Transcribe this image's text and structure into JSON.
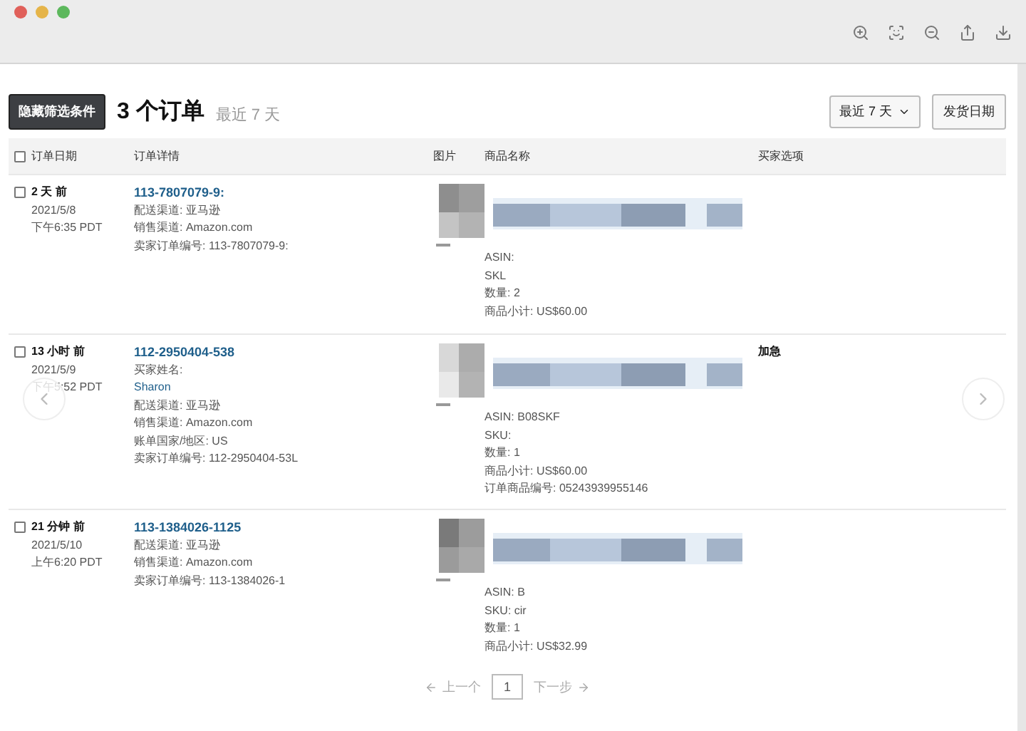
{
  "toolbar": {
    "filter_button": "隐藏筛选条件",
    "title": "3 个订单",
    "subtitle": "最近 7 天",
    "range_select": "最近 7 天",
    "sort_button": "发货日期"
  },
  "table": {
    "select_all": {
      "checked": false
    },
    "columns": [
      "订单日期",
      "订单详情",
      "图片",
      "商品名称",
      "买家选项"
    ],
    "rows": [
      {
        "checked": false,
        "age": "2 天 前",
        "date": "2021/5/8",
        "time": "下午6:35 PDT",
        "order_id": "113-7807079-9:",
        "details": [
          {
            "kind": "text",
            "text": "配送渠道: 亚马逊"
          },
          {
            "kind": "text",
            "text": "销售渠道: Amazon.com"
          },
          {
            "kind": "text",
            "text": "卖家订单编号: 113-7807079-9:"
          }
        ],
        "product": [
          "ASIN:",
          "SKL",
          "数量: 2",
          "商品小计: US$60.00"
        ],
        "buyer_option": null
      },
      {
        "checked": false,
        "age": "13 小时 前",
        "date": "2021/5/9",
        "time": "下午5:52 PDT",
        "order_id": "112-2950404-538",
        "details": [
          {
            "kind": "text",
            "text": "买家姓名:"
          },
          {
            "kind": "link",
            "text": "Sharon"
          },
          {
            "kind": "text",
            "text": "配送渠道: 亚马逊"
          },
          {
            "kind": "text",
            "text": "销售渠道: Amazon.com"
          },
          {
            "kind": "text",
            "text": "账单国家/地区: US"
          },
          {
            "kind": "text",
            "text": "卖家订单编号: 112-2950404-53L"
          }
        ],
        "product": [
          "ASIN: B08SKF",
          "SKU:",
          "数量: 1",
          "商品小计: US$60.00",
          "订单商品编号: 05243939955146"
        ],
        "buyer_option": "加急"
      },
      {
        "checked": false,
        "age": "21 分钟 前",
        "date": "2021/5/10",
        "time": "上午6:20 PDT",
        "order_id": "113-1384026-1125",
        "details": [
          {
            "kind": "text",
            "text": "配送渠道: 亚马逊"
          },
          {
            "kind": "text",
            "text": "销售渠道: Amazon.com"
          },
          {
            "kind": "text",
            "text": "卖家订单编号: 113-1384026-1"
          }
        ],
        "product": [
          "ASIN: B",
          "SKU: cir",
          "数量: 1",
          "商品小计: US$32.99"
        ],
        "buyer_option": null
      }
    ]
  },
  "pagination": {
    "previous": "上一个",
    "page": "1",
    "next": "下一步"
  }
}
